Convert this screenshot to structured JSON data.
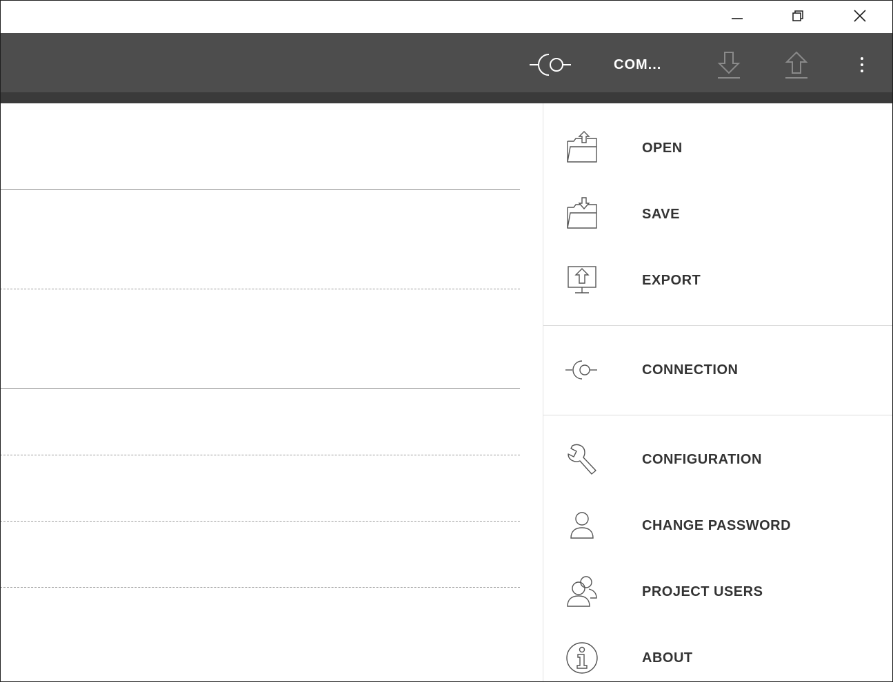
{
  "window": {
    "minimize_icon": "minimize-icon",
    "restore_icon": "restore-icon",
    "close_icon": "close-icon"
  },
  "toolbar": {
    "connection_label": "COM...",
    "connection_icon": "connection-icon",
    "download_icon": "download-icon",
    "upload_icon": "upload-icon",
    "more_icon": "more-vertical-icon",
    "colors": {
      "bar": "#4d4d4d",
      "text": "#ffffff",
      "disabled_icon": "#8a8a8a"
    }
  },
  "menu": {
    "items": [
      {
        "label": "OPEN",
        "icon": "folder-open-icon"
      },
      {
        "label": "SAVE",
        "icon": "folder-save-icon"
      },
      {
        "label": "EXPORT",
        "icon": "export-icon"
      },
      {
        "label": "CONNECTION",
        "icon": "connection-icon"
      },
      {
        "label": "CONFIGURATION",
        "icon": "wrench-icon"
      },
      {
        "label": "CHANGE PASSWORD",
        "icon": "user-icon"
      },
      {
        "label": "PROJECT USERS",
        "icon": "users-icon"
      },
      {
        "label": "ABOUT",
        "icon": "info-icon"
      }
    ]
  }
}
